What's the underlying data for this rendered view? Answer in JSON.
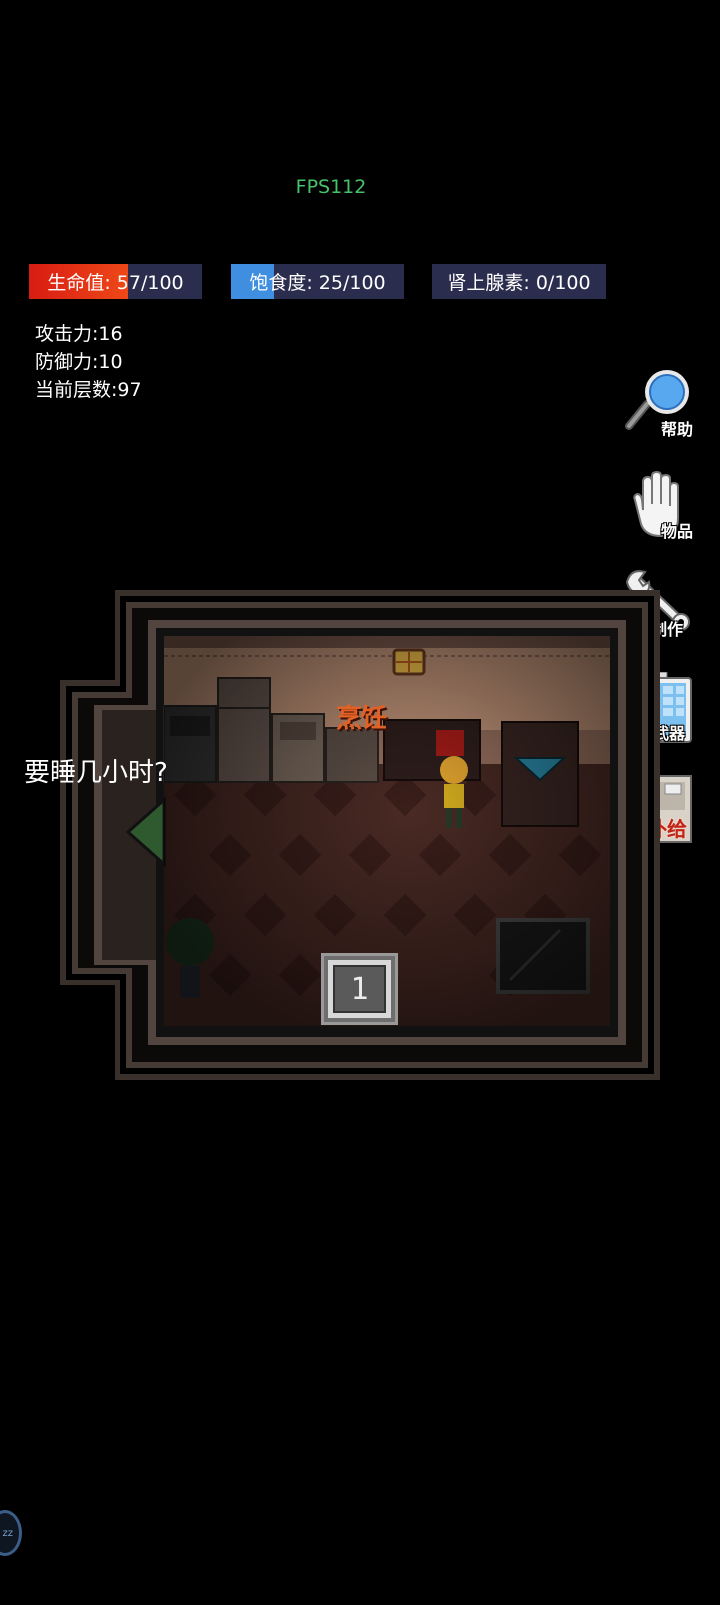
{
  "fps": "FPS112",
  "bars": {
    "hp": {
      "label": "生命值: 57/100",
      "value": 57,
      "max": 100,
      "color": "#d81c12"
    },
    "satiety": {
      "label": "饱食度: 25/100",
      "value": 25,
      "max": 100,
      "color": "#3f8ee0"
    },
    "adrenaline": {
      "label": "肾上腺素: 0/100",
      "value": 0,
      "max": 100,
      "color": "#2b2d4e"
    }
  },
  "stats": {
    "attack": "攻击力:16",
    "defense": "防御力:10",
    "floor": "当前层数:97"
  },
  "side_menu": {
    "help": "帮助",
    "items": "物品",
    "craft": "制作",
    "weapon": "武器",
    "supply": "补给"
  },
  "prompt": "要睡几小时?",
  "room": {
    "cook_label": "烹饪",
    "floor_button": "1"
  },
  "float_button": "zz"
}
